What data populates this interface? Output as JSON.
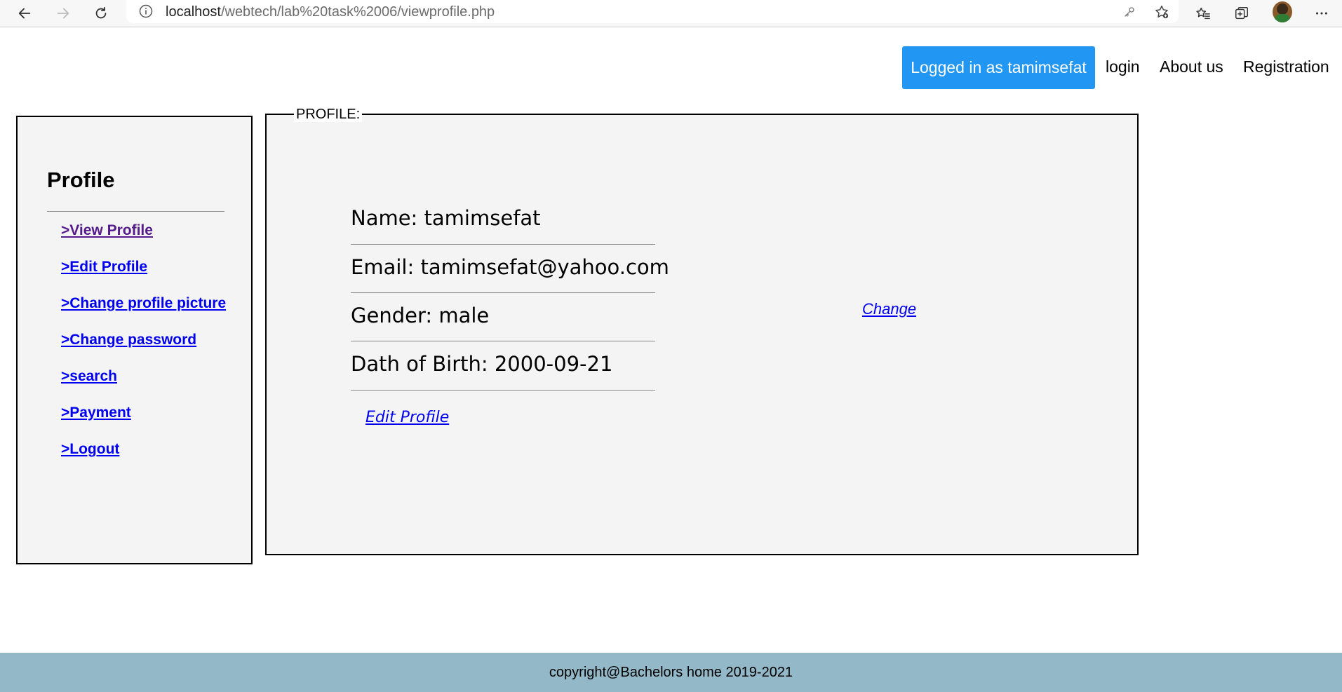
{
  "browser": {
    "url_host": "localhost",
    "url_path": "/webtech/lab%20task%2006/viewprofile.php",
    "icons": [
      "back-arrow-icon",
      "forward-arrow-icon",
      "reload-icon",
      "info-icon",
      "key-icon",
      "add-favorite-icon",
      "favorites-icon",
      "collections-icon",
      "profile-avatar",
      "more-icon"
    ]
  },
  "topnav": {
    "logged_in_label": "Logged in as tamimsefat",
    "login": "login",
    "about": "About us",
    "registration": "Registration",
    "accent_color": "#2196f3"
  },
  "sidebar": {
    "title": "Profile",
    "items": [
      {
        "label": ">View Profile"
      },
      {
        "label": ">Edit Profile"
      },
      {
        "label": ">Change profile picture"
      },
      {
        "label": ">Change password"
      },
      {
        "label": ">search"
      },
      {
        "label": ">Payment"
      },
      {
        "label": ">Logout"
      }
    ]
  },
  "profile": {
    "legend": "PROFILE:",
    "name": "Name: tamimsefat",
    "email": "Email: tamimsefat@yahoo.com",
    "gender": "Gender: male",
    "dob": "Dath of Birth: 2000-09-21",
    "edit_link": "Edit Profile",
    "change_link": "Change"
  },
  "footer": {
    "text": "copyright@Bachelors home 2019-2021",
    "color": "#93b8c8"
  }
}
